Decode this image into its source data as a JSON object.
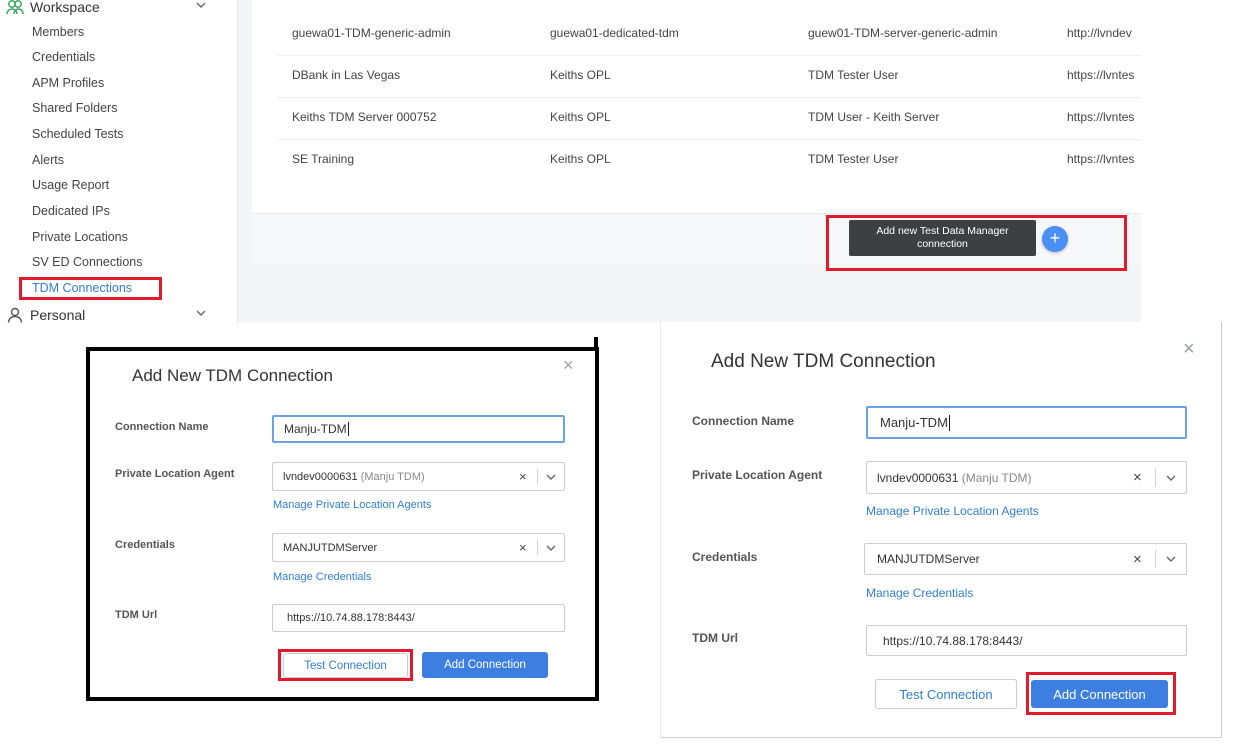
{
  "sidebar": {
    "workspace_label": "Workspace",
    "personal_label": "Personal",
    "items": [
      {
        "label": "Members"
      },
      {
        "label": "Credentials"
      },
      {
        "label": "APM Profiles"
      },
      {
        "label": "Shared Folders"
      },
      {
        "label": "Scheduled Tests"
      },
      {
        "label": "Alerts"
      },
      {
        "label": "Usage Report"
      },
      {
        "label": "Dedicated IPs"
      },
      {
        "label": "Private Locations"
      },
      {
        "label": "SV ED Connections"
      },
      {
        "label": "TDM Connections"
      }
    ],
    "active_item": "TDM Connections"
  },
  "connections_table": {
    "rows": [
      {
        "name": "guewa01-TDM-generic-admin",
        "location": "guewa01-dedicated-tdm",
        "credential": "guew01-TDM-server-generic-admin",
        "url": "http://lvndev"
      },
      {
        "name": "DBank in Las Vegas",
        "location": "Keiths OPL",
        "credential": "TDM Tester User",
        "url": "https://lvntes"
      },
      {
        "name": "Keiths TDM Server 000752",
        "location": "Keiths OPL",
        "credential": "TDM User - Keith Server",
        "url": "https://lvntes"
      },
      {
        "name": "SE Training",
        "location": "Keiths OPL",
        "credential": "TDM Tester User",
        "url": "https://lvntes"
      }
    ],
    "add_button_label": "Add new Test Data Manager connection",
    "plus_symbol": "+"
  },
  "dialogs": [
    {
      "title": "Add New TDM Connection",
      "close_symbol": "×",
      "connection_name_label": "Connection Name",
      "connection_name_value": "Manju-TDM",
      "private_location_label": "Private Location Agent",
      "private_location_value": "lvndev0000631",
      "private_location_note": "(Manju TDM)",
      "manage_agents_link": "Manage Private Location Agents",
      "credentials_label": "Credentials",
      "credentials_value": "MANJUTDMServer",
      "manage_credentials_link": "Manage Credentials",
      "url_label": "TDM Url",
      "url_value": "https://10.74.88.178:8443/",
      "test_button": "Test Connection",
      "add_button": "Add Connection",
      "clear_symbol": "×"
    },
    {
      "title": "Add New TDM Connection",
      "close_symbol": "×",
      "connection_name_label": "Connection Name",
      "connection_name_value": "Manju-TDM",
      "private_location_label": "Private Location Agent",
      "private_location_value": "lvndev0000631",
      "private_location_note": "(Manju TDM)",
      "manage_agents_link": "Manage Private Location Agents",
      "credentials_label": "Credentials",
      "credentials_value": "MANJUTDMServer",
      "manage_credentials_link": "Manage Credentials",
      "url_label": "TDM Url",
      "url_value": "https://10.74.88.178:8443/",
      "test_button": "Test Connection",
      "add_button": "Add Connection",
      "clear_symbol": "×"
    }
  ],
  "colors": {
    "highlight_red": "#e21a2c",
    "link_blue": "#2f7fd4",
    "primary_button": "#3d7fe0",
    "dark_tooltip": "#3c4043",
    "workspace_icon_green": "#3aa85a"
  },
  "icons": [
    "workspace-group-icon",
    "person-icon",
    "chevron-down-icon",
    "close-icon",
    "plus-icon"
  ]
}
